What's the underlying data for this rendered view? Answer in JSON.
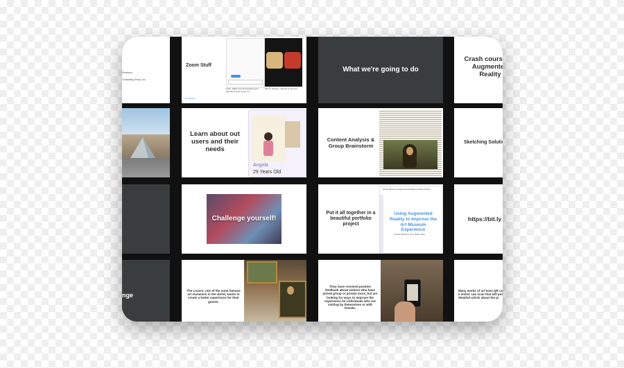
{
  "slides": {
    "s1": {
      "lines": [
        "Professor",
        "Consulting Group, Inc."
      ]
    },
    "s2": {
      "title": "Zoom Stuff",
      "chat_caption": "Chat - Make sure all questions and attendees know you're in!",
      "mic_caption": "Mic for sharing - camera is nice but",
      "footer": "UX Masters"
    },
    "s3": {
      "title": "What we're going to do"
    },
    "s4": {
      "title": "Crash course on Augmented Reality"
    },
    "s6": {
      "title": "Learn about out users and their needs",
      "persona_name": "Angela",
      "persona_age": "29 Years Old"
    },
    "s7": {
      "title": "Content Analysis & Group Brainstorm"
    },
    "s8": {
      "title": "Sketching Solutions"
    },
    "s10": {
      "title": "Challenge yourself!"
    },
    "s11": {
      "title": "Put it all together in a beautiful portfolio project",
      "doc_title": "Using Augmented Reality to Improve the Art Museum Experience",
      "doc_header": "Junior Museum Augmented Reality Portfolio Project",
      "doc_sub": "A Case Study by Your Name Here"
    },
    "s12": {
      "title": "https://bit.ly"
    },
    "s13": {
      "title": "nge"
    },
    "s14": {
      "text": "The Louvre, one of the most famous art museums in the world, wants to create a better experience for their guests."
    },
    "s15": {
      "text": "They have received positive feedback about visitors who have joined group or private tours, but are looking for ways to improve the experience for individuals who are visiting by themselves or with friends."
    },
    "s16": {
      "text": "Many works of art have QR codes, so a visitor can scan that will pull up a detailed article about the pi"
    }
  }
}
